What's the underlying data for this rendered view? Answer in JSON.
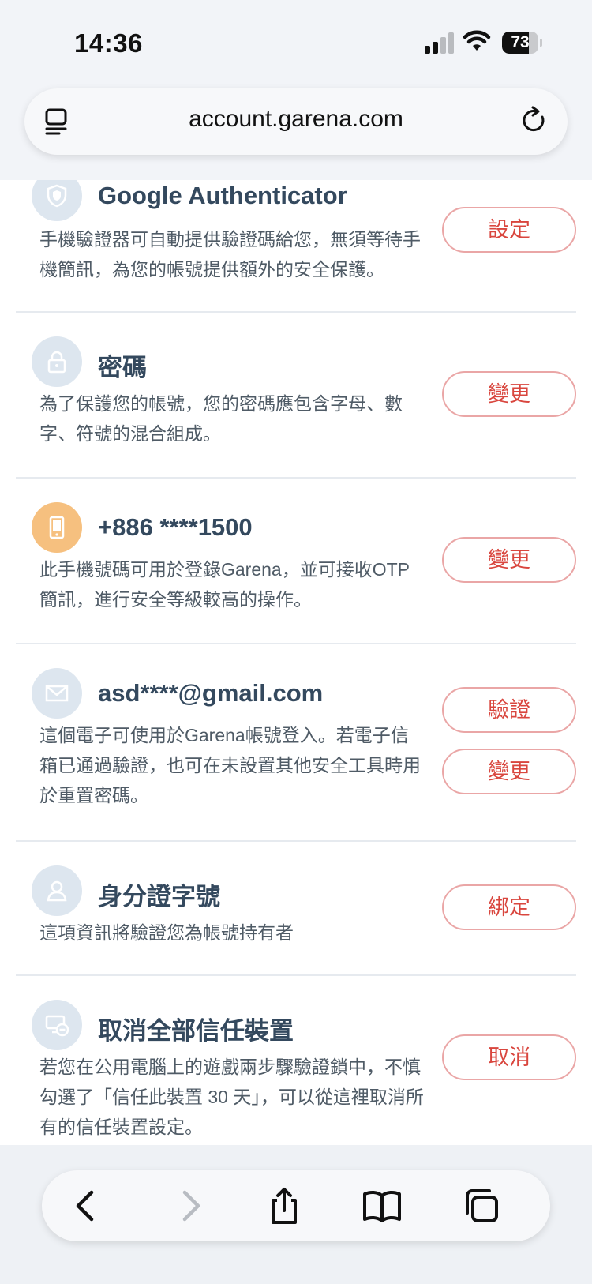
{
  "status": {
    "time": "14:36",
    "battery": "73"
  },
  "browser": {
    "url": "account.garena.com"
  },
  "items": [
    {
      "title": "Google Authenticator",
      "desc": "手機驗證器可自動提供驗證碼給您，無須等待手機簡訊，為您的帳號提供額外的安全保護。",
      "button": "設定",
      "icon": "shield-icon"
    },
    {
      "title": "密碼",
      "desc": "為了保護您的帳號，您的密碼應包含字母、數字、符號的混合組成。",
      "button": "變更",
      "icon": "lock-icon"
    },
    {
      "title": "+886 ****1500",
      "desc": "此手機號碼可用於登錄Garena，並可接收OTP簡訊，進行安全等級較高的操作。",
      "button": "變更",
      "icon": "phone-icon",
      "icon_color": "#f6c07f"
    },
    {
      "title": "asd****@gmail.com",
      "desc": "這個電子可使用於Garena帳號登入。若電子信箱已通過驗證，也可在未設置其他安全工具時用於重置密碼。",
      "button_verify": "驗證",
      "button": "變更",
      "icon": "mail-icon"
    },
    {
      "title": "身分證字號",
      "desc": "這項資訊將驗證您為帳號持有者",
      "button": "綁定",
      "icon": "id-person-icon"
    },
    {
      "title": "取消全部信任裝置",
      "desc": "若您在公用電腦上的遊戲兩步驟驗證鎖中，不慎勾選了「信任此裝置 30 天」，可以從這裡取消所有的信任裝置設定。",
      "button": "取消",
      "icon": "device-remove-icon"
    }
  ],
  "colors": {
    "accent": "#d9463e",
    "button_border": "#eaa6a6",
    "title": "#34495e",
    "icon_bg": "#dde6ef"
  }
}
